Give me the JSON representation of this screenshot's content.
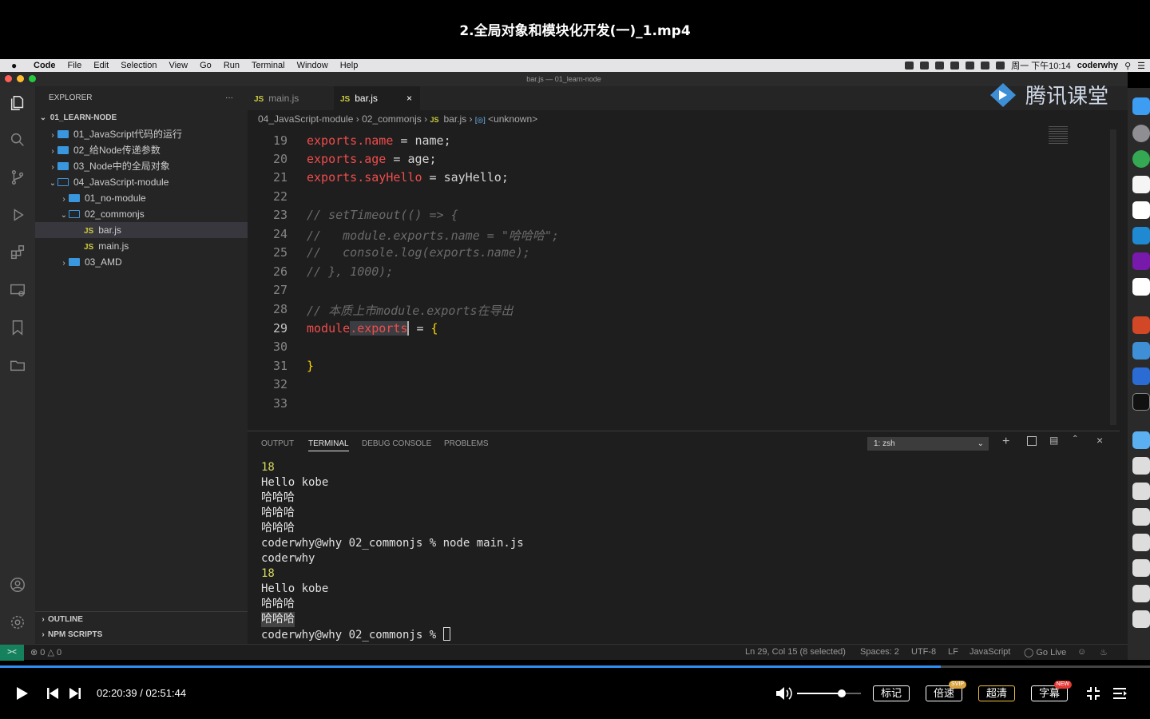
{
  "video": {
    "title": "2.全局对象和模块化开发(一)_1.mp4"
  },
  "menubar": {
    "items": [
      "Code",
      "File",
      "Edit",
      "Selection",
      "View",
      "Go",
      "Run",
      "Terminal",
      "Window",
      "Help"
    ],
    "clock": "周一 下午10:14",
    "user": "coderwhy"
  },
  "window": {
    "title": "bar.js — 01_learn-node"
  },
  "logo": {
    "text": "腾讯课堂"
  },
  "sidebar": {
    "header": "EXPLORER",
    "root": "01_LEARN-NODE",
    "items": [
      {
        "label": "01_JavaScript代码的运行",
        "type": "folder",
        "open": false
      },
      {
        "label": "02_给Node传递参数",
        "type": "folder",
        "open": false
      },
      {
        "label": "03_Node中的全局对象",
        "type": "folder",
        "open": false
      },
      {
        "label": "04_JavaScript-module",
        "type": "folder",
        "open": true
      },
      {
        "label": "01_no-module",
        "type": "folder",
        "open": false
      },
      {
        "label": "02_commonjs",
        "type": "folder",
        "open": true
      },
      {
        "label": "bar.js",
        "type": "file",
        "icon": "JS"
      },
      {
        "label": "main.js",
        "type": "file",
        "icon": "JS"
      },
      {
        "label": "03_AMD",
        "type": "folder",
        "open": false
      }
    ],
    "outline": "OUTLINE",
    "npm_scripts": "NPM SCRIPTS"
  },
  "tabs": [
    {
      "label": "main.js",
      "icon": "JS",
      "active": false
    },
    {
      "label": "bar.js",
      "icon": "JS",
      "active": true,
      "close": "×"
    }
  ],
  "breadcrumb": [
    "04_JavaScript-module",
    "02_commonjs",
    "bar.js",
    "<unknown>"
  ],
  "code": {
    "lines": [
      {
        "n": "19"
      },
      {
        "n": "20"
      },
      {
        "n": "21"
      },
      {
        "n": "22"
      },
      {
        "n": "23"
      },
      {
        "n": "24"
      },
      {
        "n": "25"
      },
      {
        "n": "26"
      },
      {
        "n": "27"
      },
      {
        "n": "28"
      },
      {
        "n": "29"
      },
      {
        "n": "30"
      },
      {
        "n": "31"
      },
      {
        "n": "32"
      },
      {
        "n": "33"
      }
    ],
    "l19": [
      "exports",
      ".name",
      " = ",
      "name;"
    ],
    "l20": [
      "exports",
      ".age",
      " = ",
      "age;"
    ],
    "l21": [
      "exports",
      ".sayHello",
      " = ",
      "sayHello;"
    ],
    "l23": "// setTimeout(() => {",
    "l24": "//   module.exports.name = \"哈哈哈\";",
    "l25": "//   console.log(exports.name);",
    "l26": "// }, 1000);",
    "l28": "// 本质上市module.exports在导出",
    "l29": [
      "module",
      ".exports",
      " = ",
      "{"
    ],
    "l31": "}"
  },
  "panel": {
    "tabs": [
      "OUTPUT",
      "TERMINAL",
      "DEBUG CONSOLE",
      "PROBLEMS"
    ],
    "active_tab": "TERMINAL",
    "shell_select": "1: zsh"
  },
  "terminal": {
    "lines": [
      "18",
      "Hello kobe",
      "哈哈哈",
      "哈哈哈",
      "哈哈哈",
      "coderwhy@why 02_commonjs % node main.js",
      "coderwhy",
      "18",
      "Hello kobe",
      "哈哈哈",
      "哈哈哈",
      "coderwhy@why 02_commonjs % "
    ]
  },
  "statusbar": {
    "problems": "0",
    "warnings": "0",
    "position": "Ln 29, Col 15 (8 selected)",
    "spaces": "Spaces: 2",
    "encoding": "UTF-8",
    "eol": "LF",
    "language": "JavaScript",
    "golive": "Go Live"
  },
  "player": {
    "time": "02:20:39 / 02:51:44",
    "progress": 0.818,
    "volume": 0.7,
    "mark": "标记",
    "speed": "倍速",
    "speed_badge": "SVIP",
    "quality": "超清",
    "subtitle": "字幕",
    "subtitle_badge": "NEW"
  },
  "colors": {
    "accent": "#2f8ef5",
    "keyword": "#f14c4c",
    "folder": "#3a96dd",
    "js": "#cbcb41"
  }
}
